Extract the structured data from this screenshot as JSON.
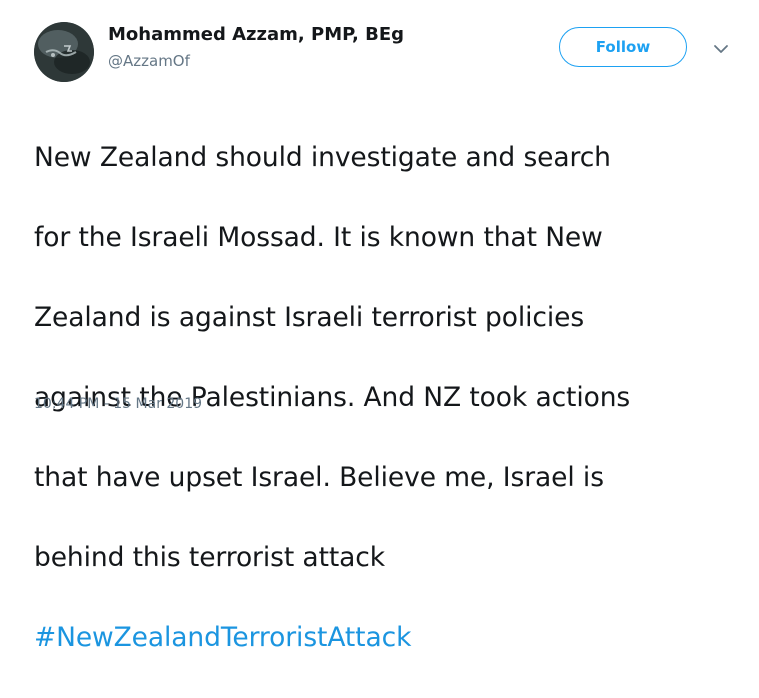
{
  "author": {
    "display_name": "Mohammed Azzam, PMP, BEg",
    "handle": "@AzzamOf",
    "avatar_icon": "profile-avatar"
  },
  "actions": {
    "follow_label": "Follow",
    "menu_icon": "chevron-down-icon"
  },
  "tweet": {
    "text_lines": [
      "New Zealand should investigate and search",
      "for the Israeli Mossad. It is known that New",
      "Zealand is against Israeli terrorist policies",
      "against the Palestinians. And NZ took actions",
      "that have upset Israel. Believe me, Israel is",
      "behind this terrorist attack"
    ],
    "hashtag": "#NewZealandTerroristAttack",
    "timestamp": "10:44 PM - 15 Mar 2019"
  },
  "colors": {
    "accent": "#1da1f2",
    "hashtag": "#1b95e0",
    "text": "#14171a",
    "secondary": "#657786"
  }
}
